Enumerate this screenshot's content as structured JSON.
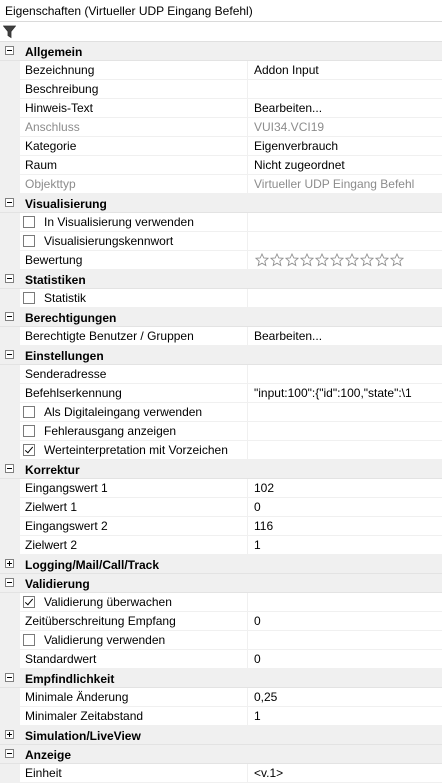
{
  "window": {
    "title": "Eigenschaften (Virtueller UDP Eingang Befehl)"
  },
  "toolbar": {
    "filter_icon": "filter-icon"
  },
  "rating": {
    "stars_total": 10,
    "stars_filled": 0
  },
  "categories": {
    "allgemein": "Allgemein",
    "visualisierung": "Visualisierung",
    "statistiken": "Statistiken",
    "berechtigungen": "Berechtigungen",
    "einstellungen": "Einstellungen",
    "korrektur": "Korrektur",
    "logging": "Logging/Mail/Call/Track",
    "validierung": "Validierung",
    "empfindlichkeit": "Empfindlichkeit",
    "simulation": "Simulation/LiveView",
    "anzeige": "Anzeige"
  },
  "allgemein": {
    "bezeichnung": {
      "label": "Bezeichnung",
      "value": "Addon Input"
    },
    "beschreibung": {
      "label": "Beschreibung",
      "value": ""
    },
    "hinweis": {
      "label": "Hinweis-Text",
      "value": "Bearbeiten..."
    },
    "anschluss": {
      "label": "Anschluss",
      "value": "VUI34.VCI19"
    },
    "kategorie": {
      "label": "Kategorie",
      "value": "Eigenverbrauch"
    },
    "raum": {
      "label": "Raum",
      "value": "Nicht zugeordnet"
    },
    "objekttyp": {
      "label": "Objekttyp",
      "value": "Virtueller UDP Eingang Befehl"
    }
  },
  "visualisierung": {
    "in_visu": {
      "label": "In Visualisierung verwenden",
      "checked": false
    },
    "kennwort": {
      "label": "Visualisierungskennwort",
      "checked": false
    },
    "bewertung": {
      "label": "Bewertung"
    }
  },
  "statistiken": {
    "statistik": {
      "label": "Statistik",
      "checked": false
    }
  },
  "berechtigungen": {
    "benutzer": {
      "label": "Berechtigte Benutzer / Gruppen",
      "value": "Bearbeiten..."
    }
  },
  "einstellungen": {
    "sender": {
      "label": "Senderadresse",
      "value": ""
    },
    "befehl": {
      "label": "Befehlserkennung",
      "value": "\"input:100\":{\"id\":100,\"state\":\\1"
    },
    "digital": {
      "label": "Als Digitaleingang verwenden",
      "checked": false
    },
    "fehler": {
      "label": "Fehlerausgang anzeigen",
      "checked": false
    },
    "vorzeichen": {
      "label": "Werteinterpretation mit Vorzeichen",
      "checked": true
    }
  },
  "korrektur": {
    "ein1": {
      "label": "Eingangswert 1",
      "value": "102"
    },
    "ziel1": {
      "label": "Zielwert 1",
      "value": "0"
    },
    "ein2": {
      "label": "Eingangswert 2",
      "value": "116"
    },
    "ziel2": {
      "label": "Zielwert 2",
      "value": "1"
    }
  },
  "validierung": {
    "ueberwachen": {
      "label": "Validierung überwachen",
      "checked": true
    },
    "zeit": {
      "label": "Zeitüberschreitung Empfang",
      "value": "0"
    },
    "verwenden": {
      "label": "Validierung verwenden",
      "checked": false
    },
    "standard": {
      "label": "Standardwert",
      "value": "0"
    }
  },
  "empfindlichkeit": {
    "aenderung": {
      "label": "Minimale Änderung",
      "value": "0,25"
    },
    "abstand": {
      "label": "Minimaler Zeitabstand",
      "value": "1"
    }
  },
  "anzeige": {
    "einheit": {
      "label": "Einheit",
      "value": "<v.1>"
    }
  }
}
